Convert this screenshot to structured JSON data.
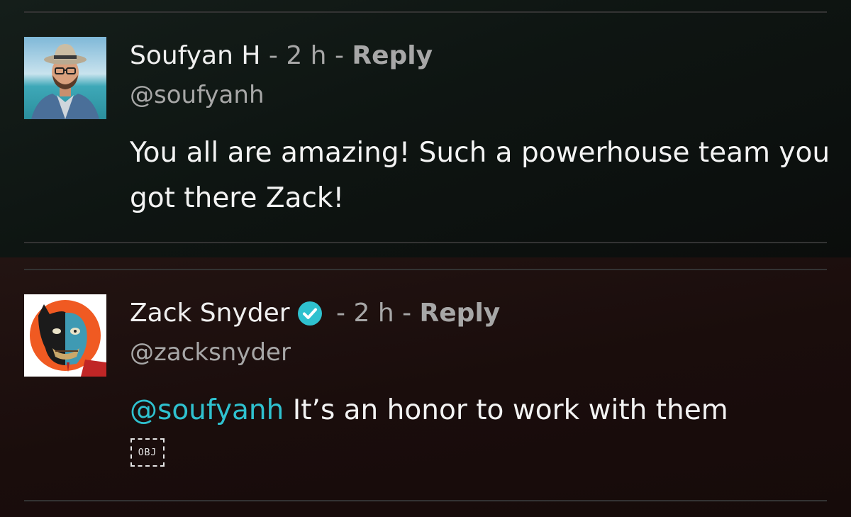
{
  "comments": [
    {
      "author": "Soufyan H",
      "separator1": " - ",
      "time": "2 h",
      "separator2": " - ",
      "reply_label": "Reply",
      "handle": "@soufyanh",
      "text": "You all are amazing! Such a powerhouse team you got there Zack!"
    },
    {
      "author": "Zack Snyder",
      "verified": true,
      "separator1": " - ",
      "time": "2 h",
      "separator2": " - ",
      "reply_label": "Reply",
      "handle": "@zacksnyder",
      "mention": "@soufyanh",
      "text": " It’s an honor to work with them",
      "attachment_label": "OBJ"
    }
  ],
  "colors": {
    "mention": "#2fc1cf",
    "verified_badge": "#2fc1cf",
    "meta_text": "#a7a7a7"
  },
  "icons": {
    "verified": "verified-check-icon"
  }
}
